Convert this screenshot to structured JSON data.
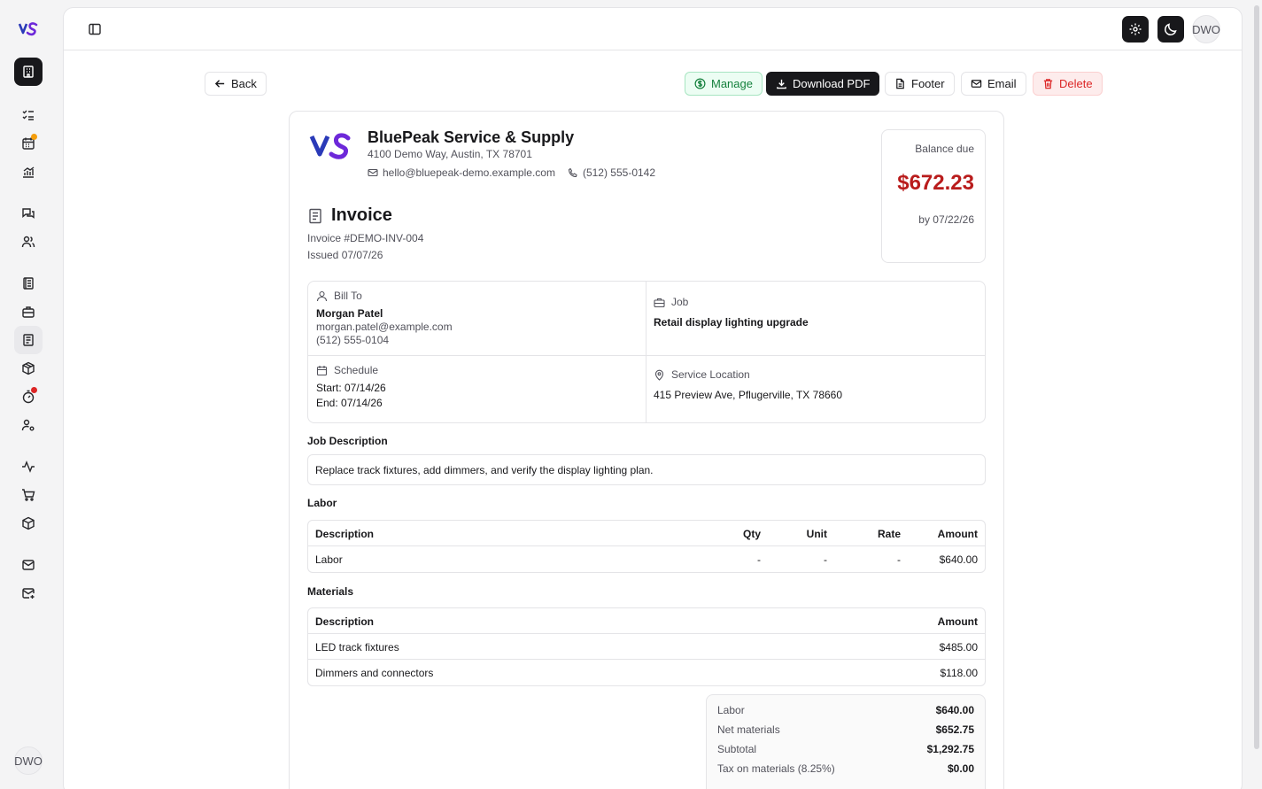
{
  "sidebar": {
    "avatar": "DWO"
  },
  "header": {
    "avatar": "DWO"
  },
  "toolbar": {
    "back": "Back",
    "manage": "Manage",
    "download": "Download PDF",
    "footer": "Footer",
    "email": "Email",
    "delete": "Delete"
  },
  "company": {
    "name": "BluePeak Service & Supply",
    "address": "4100 Demo Way, Austin, TX 78701",
    "email": "hello@bluepeak-demo.example.com",
    "phone": "(512) 555-0142"
  },
  "balance": {
    "label": "Balance due",
    "amount": "$672.23",
    "due": "by 07/22/26"
  },
  "invoice": {
    "title": "Invoice",
    "number": "Invoice #DEMO-INV-004",
    "issued": "Issued 07/07/26"
  },
  "bill_to": {
    "label": "Bill To",
    "name": "Morgan Patel",
    "email": "morgan.patel@example.com",
    "phone": "(512) 555-0104"
  },
  "job": {
    "label": "Job",
    "name": "Retail display lighting upgrade"
  },
  "schedule": {
    "label": "Schedule",
    "start": "Start: 07/14/26",
    "end": "End: 07/14/26"
  },
  "location": {
    "label": "Service Location",
    "address": "415 Preview Ave, Pflugerville, TX 78660"
  },
  "job_description": {
    "label": "Job Description",
    "text": "Replace track fixtures, add dimmers, and verify the display lighting plan."
  },
  "labor": {
    "label": "Labor",
    "headers": [
      "Description",
      "Qty",
      "Unit",
      "Rate",
      "Amount"
    ],
    "rows": [
      [
        "Labor",
        "-",
        "-",
        "-",
        "$640.00"
      ]
    ]
  },
  "materials": {
    "label": "Materials",
    "headers": [
      "Description",
      "Amount"
    ],
    "rows": [
      [
        "LED track fixtures",
        "$485.00"
      ],
      [
        "Dimmers and connectors",
        "$118.00"
      ]
    ]
  },
  "totals": [
    [
      "Labor",
      "$640.00"
    ],
    [
      "Net materials",
      "$652.75"
    ],
    [
      "Subtotal",
      "$1,292.75"
    ],
    [
      "Tax on materials (8.25%)",
      "$0.00"
    ]
  ],
  "colors": {
    "accent": "#18181b",
    "brand_blue": "#2a3ab8",
    "brand_purple": "#6d28d9",
    "balance_red": "#b91c1c",
    "notify_orange": "#f59e0b",
    "notify_red": "#dc2626"
  }
}
